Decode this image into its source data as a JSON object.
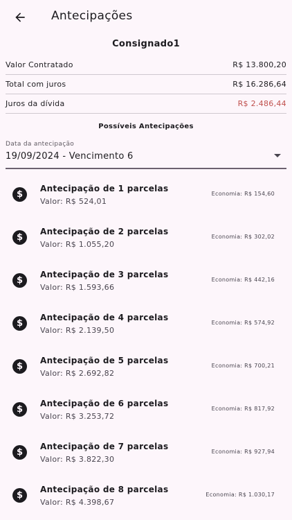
{
  "appbar": {
    "title": "Antecipações",
    "back_icon": "arrow-left-icon"
  },
  "loan": {
    "name": "Consignado1"
  },
  "summary": [
    {
      "label": "Valor Contratado",
      "value": "R$ 13.800,20",
      "color": "#1c1b1f"
    },
    {
      "label": "Total com juros",
      "value": "R$ 16.286,64",
      "color": "#1c1b1f"
    },
    {
      "label": "Juros da dívida",
      "value": "R$ 2.486,44",
      "color": "#c0504d"
    }
  ],
  "section": {
    "title": "Possíveis Antecipações"
  },
  "date_select": {
    "label": "Data da antecipação",
    "value": "19/09/2024 - Vencimento 6"
  },
  "items": [
    {
      "title": "Antecipação de 1 parcelas",
      "value": "Valor: R$ 524,01",
      "economy": "Economia: R$ 154,60"
    },
    {
      "title": "Antecipação de 2 parcelas",
      "value": "Valor: R$ 1.055,20",
      "economy": "Economia: R$ 302,02"
    },
    {
      "title": "Antecipação de 3 parcelas",
      "value": "Valor: R$ 1.593,66",
      "economy": "Economia: R$ 442,16"
    },
    {
      "title": "Antecipação de 4 parcelas",
      "value": "Valor: R$ 2.139,50",
      "economy": "Economia: R$ 574,92"
    },
    {
      "title": "Antecipação de 5 parcelas",
      "value": "Valor: R$ 2.692,82",
      "economy": "Economia: R$ 700,21"
    },
    {
      "title": "Antecipação de 6 parcelas",
      "value": "Valor: R$ 3.253,72",
      "economy": "Economia: R$ 817,92"
    },
    {
      "title": "Antecipação de 7 parcelas",
      "value": "Valor: R$ 3.822,30",
      "economy": "Economia: R$ 927,94"
    },
    {
      "title": "Antecipação de 8 parcelas",
      "value": "Valor: R$ 4.398,67",
      "economy": "Economia: R$ 1.030,17"
    }
  ],
  "item_icon": "dollar-coin-icon",
  "colors": {
    "background": "#fdf6fb",
    "text": "#1c1b1f",
    "negative": "#c0504d"
  }
}
